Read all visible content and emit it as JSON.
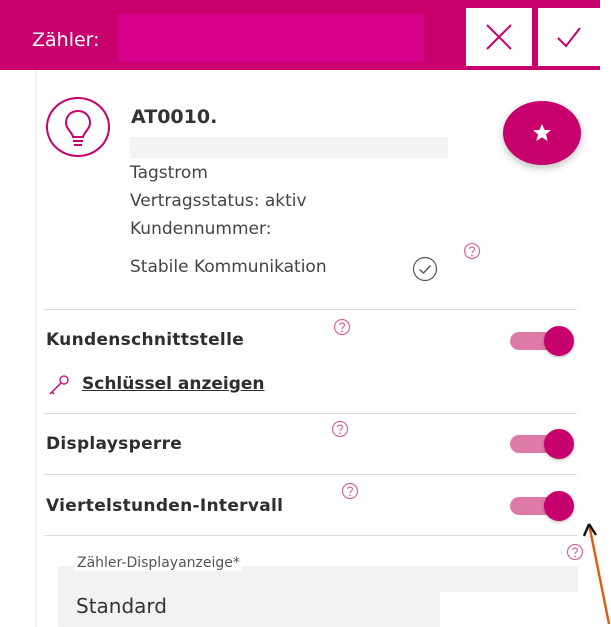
{
  "header": {
    "title": "Zähler:",
    "close_icon": "close-x-icon",
    "confirm_icon": "checkmark-icon",
    "accent": "#c8006e"
  },
  "meter": {
    "id": "AT0010.",
    "tariff": "Tagstrom",
    "contract_status": "Vertragsstatus: aktiv",
    "customer_number": "Kundennummer:",
    "communication": "Stabile Kommunikation",
    "icon": "lightbulb-icon",
    "favorite_icon": "star-icon"
  },
  "settings": {
    "customer_interface": {
      "label": "Kundenschnittstelle",
      "enabled": true
    },
    "show_key_link": "Schlüssel anzeigen",
    "display_lock": {
      "label": "Displaysperre",
      "enabled": true
    },
    "quarter_hour": {
      "label": "Viertelstunden-Intervall",
      "enabled": true
    }
  },
  "display_select": {
    "label": "Zähler-Displayanzeige*",
    "value": "Standard"
  }
}
